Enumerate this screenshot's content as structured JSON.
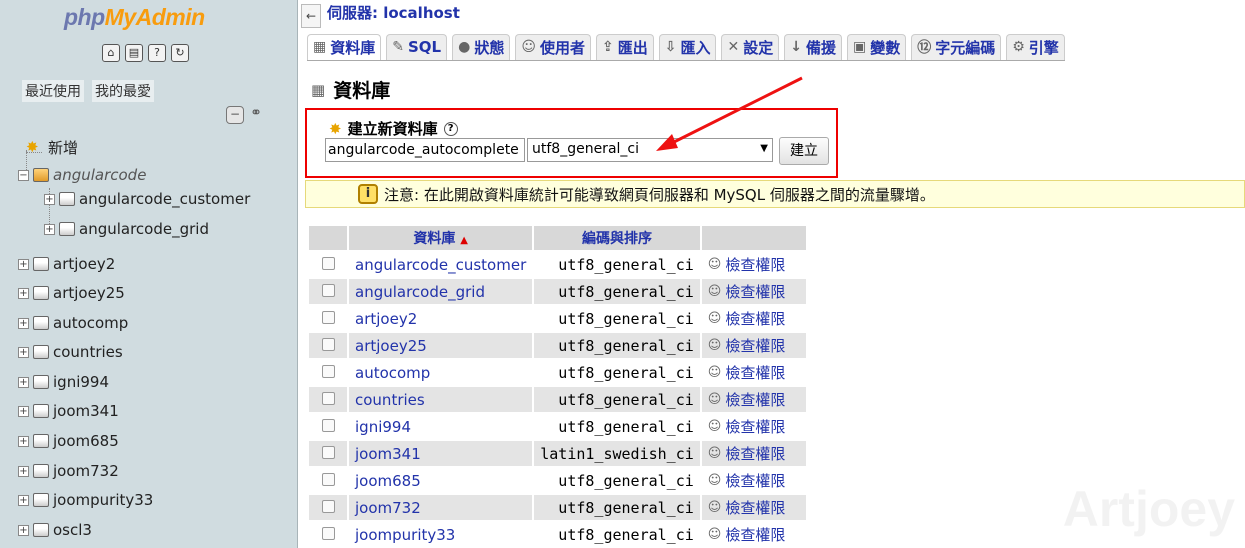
{
  "nav": {
    "logo": {
      "php": "php",
      "my": "My",
      "admin": "Admin"
    },
    "icons": [
      "home-icon",
      "sql-query-icon",
      "docs-icon",
      "reload-icon"
    ],
    "tabs": [
      "最近使用",
      "我的最愛"
    ],
    "new_label": "新增",
    "databases": [
      {
        "name": "angularcode",
        "expanded": true,
        "children": [
          "angularcode_customer",
          "angularcode_grid"
        ]
      },
      {
        "name": "artjoey2"
      },
      {
        "name": "artjoey25"
      },
      {
        "name": "autocomp"
      },
      {
        "name": "countries"
      },
      {
        "name": "igni994"
      },
      {
        "name": "joom341"
      },
      {
        "name": "joom685"
      },
      {
        "name": "joom732"
      },
      {
        "name": "joompurity33"
      },
      {
        "name": "oscl3"
      }
    ]
  },
  "header": {
    "server_crumb": "伺服器: localhost",
    "tabs": [
      {
        "label": "資料庫",
        "icon": "database-icon",
        "active": true
      },
      {
        "label": "SQL",
        "icon": "sql-icon"
      },
      {
        "label": "狀態",
        "icon": "status-icon"
      },
      {
        "label": "使用者",
        "icon": "users-icon"
      },
      {
        "label": "匯出",
        "icon": "export-icon"
      },
      {
        "label": "匯入",
        "icon": "import-icon"
      },
      {
        "label": "設定",
        "icon": "settings-icon"
      },
      {
        "label": "備援",
        "icon": "replication-icon"
      },
      {
        "label": "變數",
        "icon": "variables-icon"
      },
      {
        "label": "字元編碼",
        "icon": "charset-icon"
      },
      {
        "label": "引擎",
        "icon": "engines-icon"
      }
    ]
  },
  "main": {
    "title": "資料庫",
    "create": {
      "title": "建立新資料庫",
      "name_value": "angularcode_autocomplete",
      "collation_value": "utf8_general_ci",
      "button_label": "建立"
    },
    "notice": "注意: 在此開啟資料庫統計可能導致網頁伺服器和 MySQL 伺服器之間的流量驟增。",
    "table": {
      "headers": {
        "database": "資料庫",
        "collation": "編碼與排序"
      },
      "privileges_label": "檢查權限",
      "rows": [
        {
          "name": "angularcode_customer",
          "collation": "utf8_general_ci"
        },
        {
          "name": "angularcode_grid",
          "collation": "utf8_general_ci"
        },
        {
          "name": "artjoey2",
          "collation": "utf8_general_ci"
        },
        {
          "name": "artjoey25",
          "collation": "utf8_general_ci"
        },
        {
          "name": "autocomp",
          "collation": "utf8_general_ci"
        },
        {
          "name": "countries",
          "collation": "utf8_general_ci"
        },
        {
          "name": "igni994",
          "collation": "utf8_general_ci"
        },
        {
          "name": "joom341",
          "collation": "latin1_swedish_ci"
        },
        {
          "name": "joom685",
          "collation": "utf8_general_ci"
        },
        {
          "name": "joom732",
          "collation": "utf8_general_ci"
        },
        {
          "name": "joompurity33",
          "collation": "utf8_general_ci"
        }
      ]
    },
    "watermark": "Artjoey"
  },
  "colors": {
    "link": "#2233aa",
    "nav_bg": "#d0dce0",
    "highlight_box": "#ee0000",
    "notice_bg": "#ffffdd"
  }
}
